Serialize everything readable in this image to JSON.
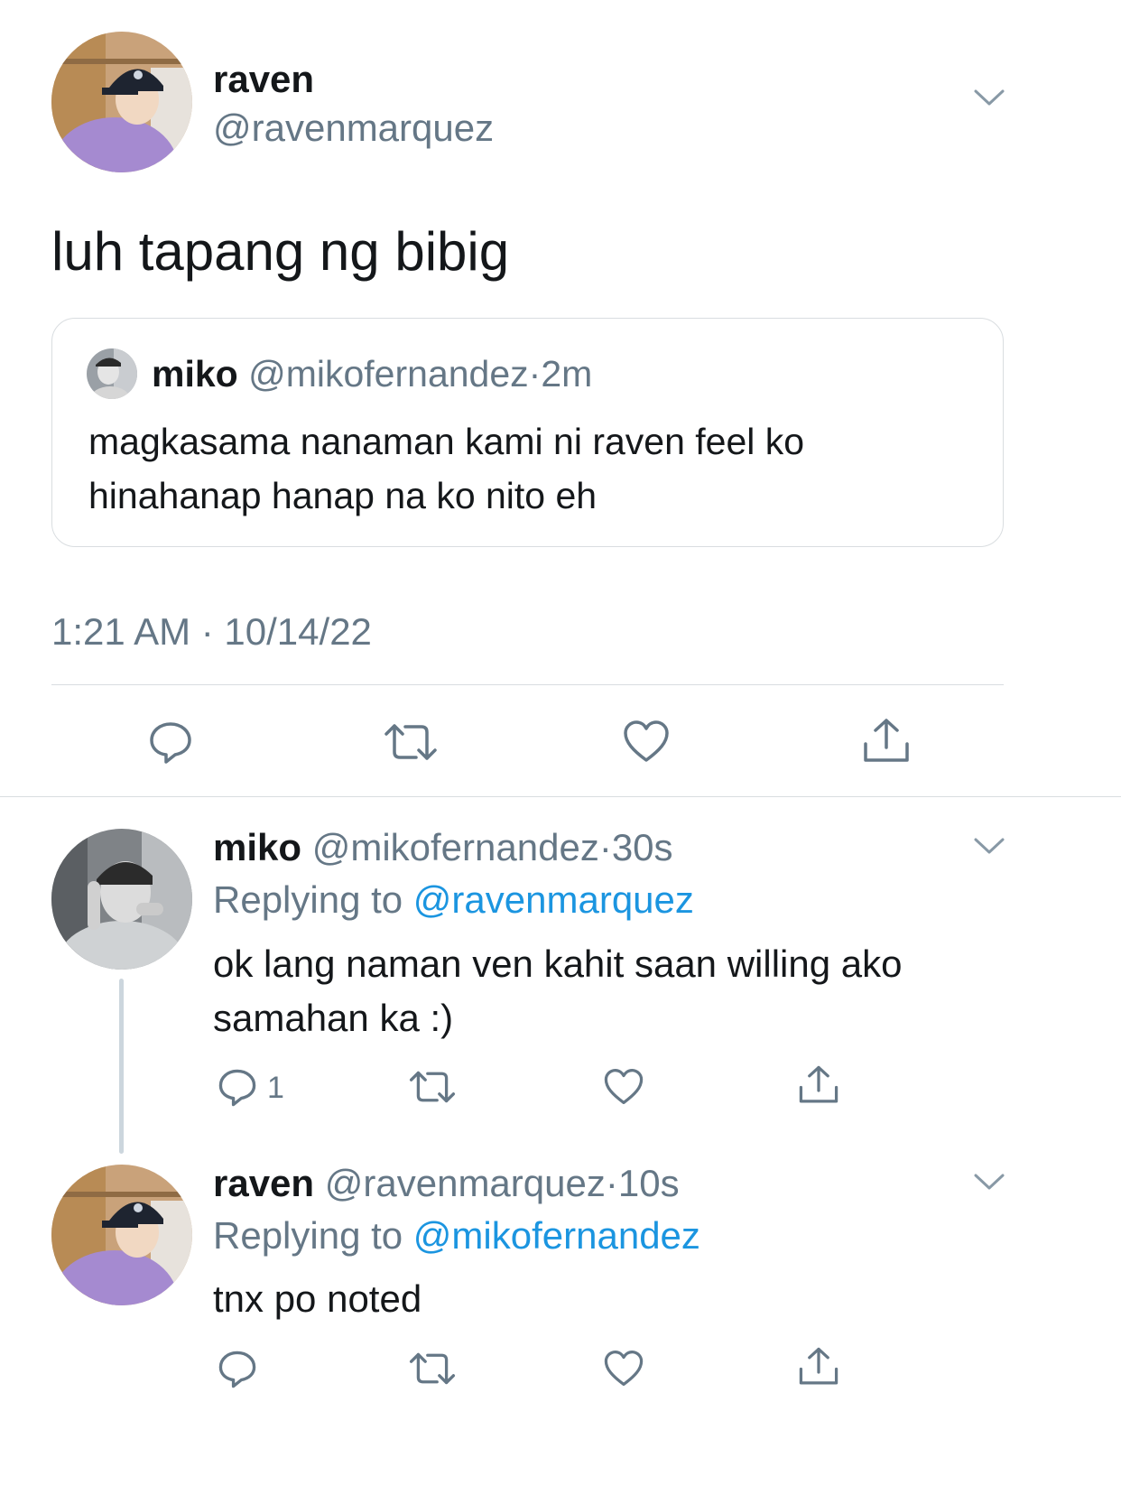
{
  "main_tweet": {
    "display_name": "raven",
    "handle": "@ravenmarquez",
    "text": "luh tapang ng bibig",
    "timestamp": "1:21 AM · 10/14/22",
    "quoted": {
      "display_name": "miko",
      "handle": "@mikofernandez",
      "sep": "·",
      "time": "2m",
      "text_line1": "magkasama nanaman kami ni raven feel ko",
      "text_line2": "hinahanap hanap na ko nito eh"
    }
  },
  "replies": [
    {
      "display_name": "miko",
      "handle": "@mikofernandez",
      "sep": "·",
      "time": "30s",
      "replying_prefix": "Replying to",
      "replying_to": "@ravenmarquez",
      "text_line1": "ok lang naman ven kahit saan willing ako",
      "text_line2": "samahan ka :)",
      "reply_count": "1"
    },
    {
      "display_name": "raven",
      "handle": "@ravenmarquez",
      "sep": "·",
      "time": "10s",
      "replying_prefix": "Replying to",
      "replying_to": "@mikofernandez",
      "text_line1": "tnx po noted"
    }
  ],
  "icons": {
    "reply": "reply-icon",
    "retweet": "retweet-icon",
    "like": "heart-icon",
    "share": "share-icon",
    "more": "chevron-down-icon"
  },
  "colors": {
    "link": "#1b95e0",
    "muted": "#657786",
    "icon": "#657786",
    "thread_line": "#ccd6dd",
    "border": "#d9dde0"
  }
}
